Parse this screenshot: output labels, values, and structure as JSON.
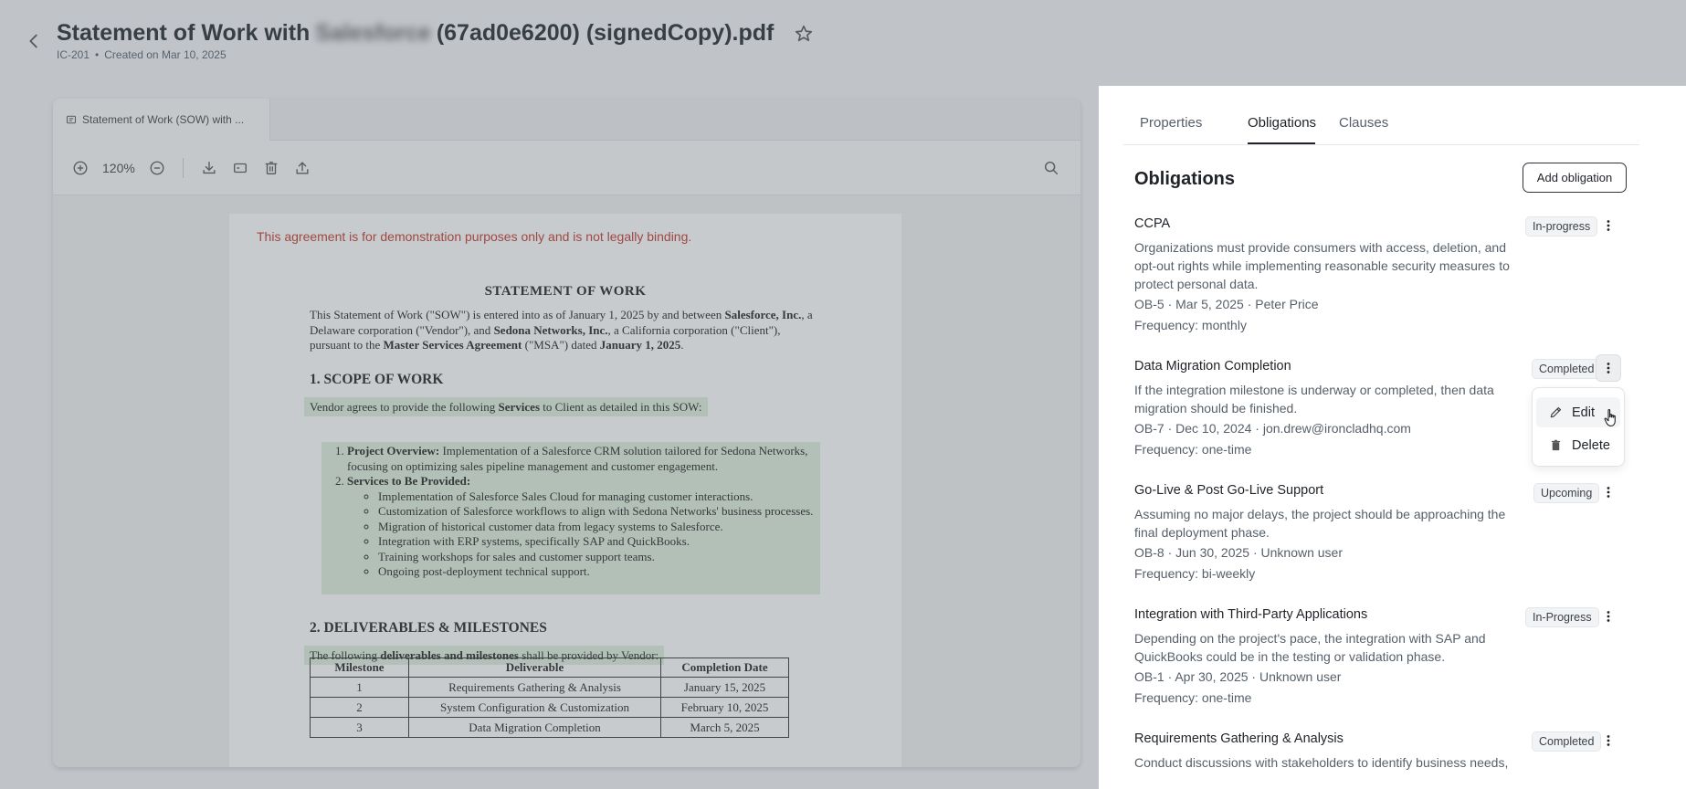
{
  "header": {
    "title_prefix": "Statement of Work with",
    "title_blurred": "Salesforce",
    "title_suffix": "(67ad0e6200) (signedCopy).pdf",
    "doc_id": "IC-201",
    "created": "Created on Mar 10, 2025"
  },
  "viewer": {
    "tab_label": "Statement of Work (SOW) with ...",
    "zoom": "120%"
  },
  "document": {
    "disclaimer": "This agreement is for demonstration purposes only and is not legally binding.",
    "title": "STATEMENT OF WORK",
    "intro": {
      "p1": "This Statement of Work (\"SOW\") is entered into as of January 1, 2025 by and between ",
      "b1": "Salesforce, Inc.",
      "p2": ", a Delaware corporation (\"Vendor\"), and ",
      "b2": "Sedona Networks, Inc.",
      "p3": ", a California corporation (\"Client\"), pursuant to the ",
      "b3": "Master Services Agreement",
      "p4": " (\"MSA\") dated ",
      "b4": "January 1, 2025",
      "p5": "."
    },
    "section1_heading": "1. SCOPE OF WORK",
    "section1_para_pre": "Vendor agrees to provide the following ",
    "section1_para_bold": "Services",
    "section1_para_post": " to Client as detailed in this SOW:",
    "item1_label": "Project Overview:",
    "item1_text": " Implementation of a Salesforce CRM solution tailored for Sedona Networks, focusing on optimizing sales pipeline management and customer engagement.",
    "item2_label": "Services to Be Provided:",
    "services": [
      "Implementation of Salesforce Sales Cloud for managing customer interactions.",
      "Customization of Salesforce workflows to align with Sedona Networks' business processes.",
      "Migration of historical customer data from legacy systems to Salesforce.",
      "Integration with ERP systems, specifically SAP and QuickBooks.",
      "Training workshops for sales and customer support teams.",
      "Ongoing post-deployment technical support."
    ],
    "section2_heading": "2. DELIVERABLES & MILESTONES",
    "section2_para_pre": "The following ",
    "section2_para_bold": "deliverables and milestones",
    "section2_para_post": " shall be provided by Vendor:",
    "table_headers": [
      "Milestone",
      "Deliverable",
      "Completion Date"
    ],
    "table_rows": [
      [
        "1",
        "Requirements Gathering & Analysis",
        "January 15, 2025"
      ],
      [
        "2",
        "System Configuration & Customization",
        "February 10, 2025"
      ],
      [
        "3",
        "Data Migration Completion",
        "March 5, 2025"
      ]
    ]
  },
  "panel": {
    "tabs": [
      "Properties",
      "Obligations",
      "Clauses"
    ],
    "active_tab": "Obligations",
    "section_title": "Obligations",
    "add_button": "Add obligation",
    "obligations": [
      {
        "title": "CCPA",
        "status": "In-progress",
        "description": "Organizations must provide consumers with access, deletion, and opt-out rights while implementing reasonable security measures to protect personal data.",
        "meta": "OB-5 · Mar 5, 2025 · Peter Price",
        "frequency": "Frequency: monthly"
      },
      {
        "title": "Data Migration Completion",
        "status": "Completed",
        "description": "If the integration milestone is underway or completed, then data migration should be finished.",
        "meta": "OB-7 · Dec 10, 2024 · jon.drew@ironcladhq.com",
        "frequency": "Frequency: one-time"
      },
      {
        "title": "Go-Live & Post Go-Live Support",
        "status": "Upcoming",
        "description": "Assuming no major delays, the project should be approaching the final deployment phase.",
        "meta": "OB-8 · Jun 30, 2025 · Unknown user",
        "frequency": "Frequency: bi-weekly"
      },
      {
        "title": "Integration with Third-Party Applications",
        "status": "In-Progress",
        "description": "Depending on the project's pace, the integration with SAP and QuickBooks could be in the testing or validation phase.",
        "meta": "OB-1 · Apr 30, 2025 · Unknown user",
        "frequency": "Frequency: one-time"
      },
      {
        "title": "Requirements Gathering & Analysis",
        "status": "Completed",
        "description": "Conduct discussions with stakeholders to identify business needs,"
      }
    ],
    "menu": {
      "edit": "Edit",
      "delete": "Delete"
    }
  }
}
